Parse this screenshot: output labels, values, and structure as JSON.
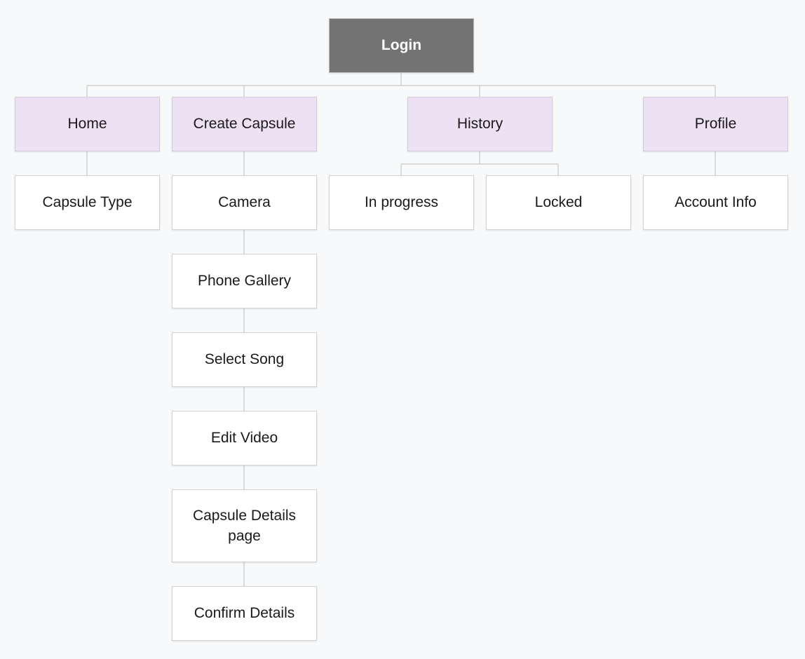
{
  "root": {
    "label": "Login"
  },
  "sections": {
    "home": {
      "label": "Home",
      "children": [
        {
          "label": "Capsule Type"
        }
      ]
    },
    "create_capsule": {
      "label": "Create Capsule",
      "children": [
        {
          "label": "Camera"
        },
        {
          "label": "Phone Gallery"
        },
        {
          "label": "Select Song"
        },
        {
          "label": "Edit Video"
        },
        {
          "label": "Capsule Details page"
        },
        {
          "label": "Confirm Details"
        }
      ]
    },
    "history": {
      "label": "History",
      "children": [
        {
          "label": "In progress"
        },
        {
          "label": "Locked"
        }
      ]
    },
    "profile": {
      "label": "Profile",
      "children": [
        {
          "label": "Account Info"
        }
      ]
    }
  },
  "colors": {
    "background": "#f8f9fa",
    "root_fill": "#737373",
    "section_fill": "#ede1f4",
    "leaf_fill": "#ffffff",
    "connector": "#cfcfcf"
  }
}
